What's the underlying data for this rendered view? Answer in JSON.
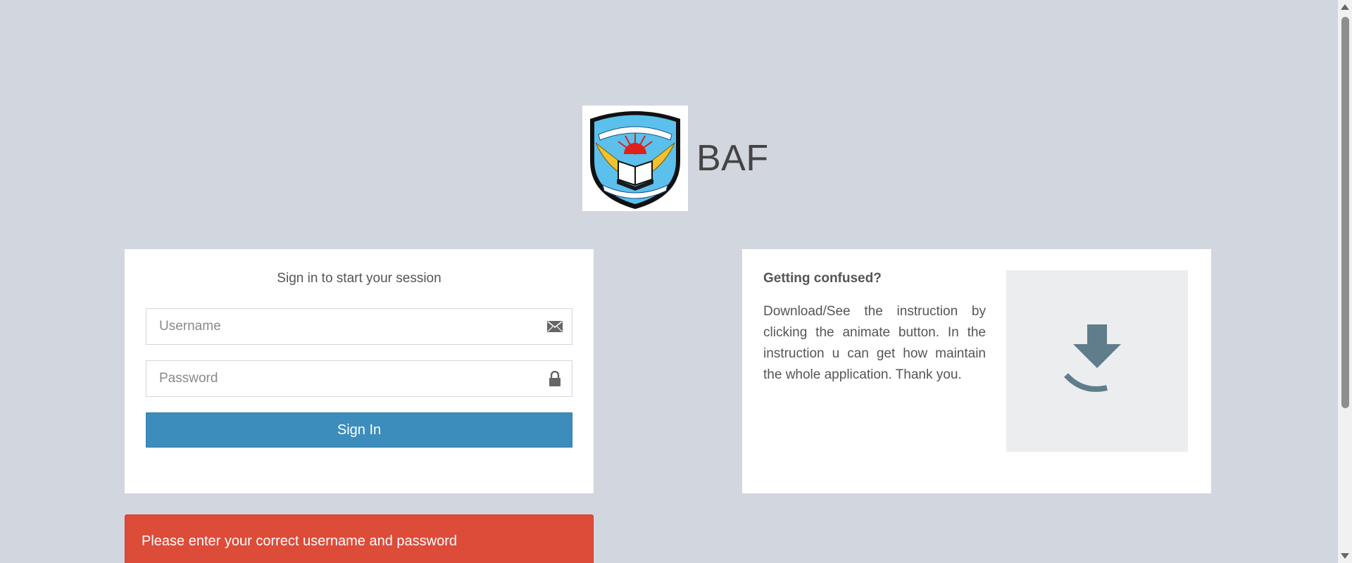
{
  "brand": {
    "logo_icon": "college-crest-logo",
    "logo_banner_top": "BAF SHAHEEN ENGLISH MEDIUM COLLEGE",
    "logo_banner_bottom": "EDUCATION DISCIPLINE",
    "name": "BAF"
  },
  "login": {
    "message": "Sign in to start your session",
    "username_placeholder": "Username",
    "username_icon": "envelope-icon",
    "password_placeholder": "Password",
    "password_icon": "lock-icon",
    "submit_label": "Sign In"
  },
  "help": {
    "title": "Getting confused?",
    "body": "Download/See the instruction by clicking the animate button. In the instruction u can get how maintain the whole application. Thank you.",
    "download_icon": "download-icon"
  },
  "alert": {
    "message": "Please enter your correct username and password"
  },
  "colors": {
    "page_bg": "#d2d6de",
    "primary": "#3c8dbc",
    "danger": "#dd4b39",
    "download_icon": "#607d8b"
  }
}
